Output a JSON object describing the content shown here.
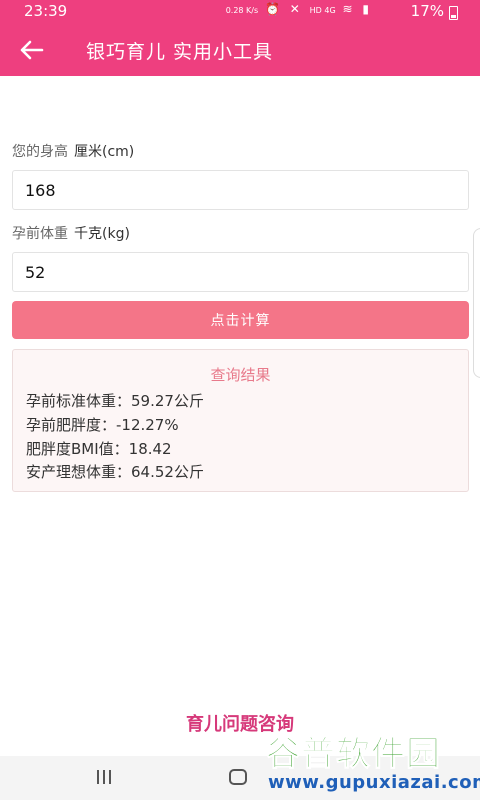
{
  "status_bar": {
    "time": "23:39",
    "net_speed": "0.28 K/s",
    "network": "HD 4G",
    "battery": "17%"
  },
  "header": {
    "title": "银巧育儿 实用小工具",
    "back_icon": "arrow-left-icon",
    "background": "#ee3f7f"
  },
  "form": {
    "height": {
      "label": "您的身高",
      "unit": "厘米(cm)",
      "value": "168"
    },
    "weight": {
      "label": "孕前体重",
      "unit": "千克(kg)",
      "value": "52"
    },
    "calculate_label": "点击计算",
    "button_color": "#f47588"
  },
  "result": {
    "title": "查询结果",
    "lines": [
      "孕前标准体重：59.27公斤",
      "孕前肥胖度：-12.27%",
      "肥胖度BMI值：18.42",
      "安产理想体重：64.52公斤"
    ]
  },
  "consult_link": "育儿问题咨询",
  "watermark": {
    "main": "谷普软件园",
    "url": "www.gupuxiazai.com"
  }
}
